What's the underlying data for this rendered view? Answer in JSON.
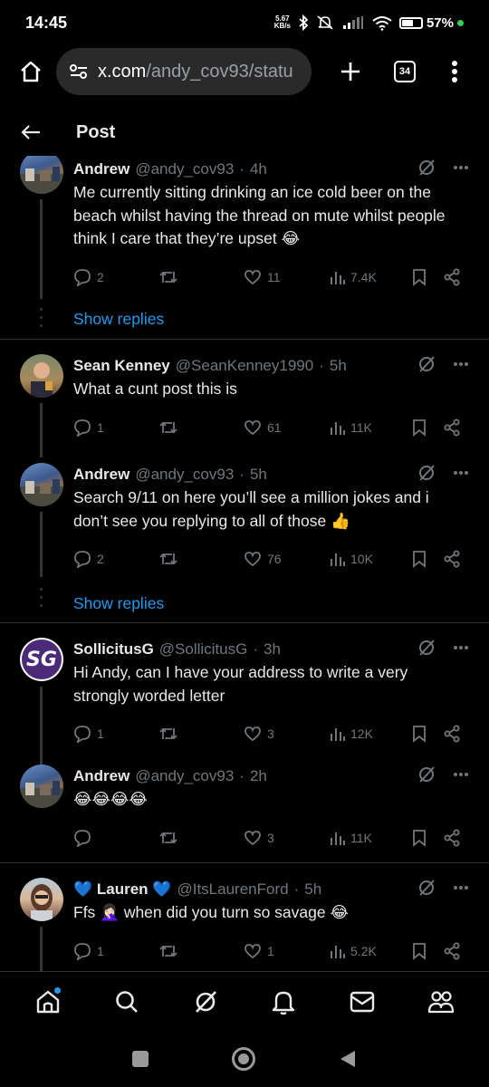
{
  "status_bar": {
    "time": "14:45",
    "net_speed_value": "5.67",
    "net_speed_unit": "KB/s",
    "battery": "57%"
  },
  "browser": {
    "url_host": "x.com",
    "url_path": "/andy_cov93/statu",
    "tab_count": "34"
  },
  "header": {
    "title": "Post"
  },
  "replies": [
    {
      "name": "Andrew",
      "handle": "@andy_cov93",
      "time": "4h",
      "text": "Me currently sitting drinking an ice cold beer on the beach whilst having the thread on mute whilst people think I care that they’re upset 😂",
      "replies": "2",
      "likes": "11",
      "views": "7.4K",
      "show_replies": "Show replies"
    },
    {
      "name": "Sean Kenney",
      "handle": "@SeanKenney1990",
      "time": "5h",
      "text": "What a cunt post this is",
      "replies": "1",
      "likes": "61",
      "views": "11K"
    },
    {
      "name": "Andrew",
      "handle": "@andy_cov93",
      "time": "5h",
      "text": "Search 9/11 on here you’ll see a million jokes and i don’t see you replying to all of those 👍",
      "replies": "2",
      "likes": "76",
      "views": "10K",
      "show_replies": "Show replies"
    },
    {
      "name": "SollicitusG",
      "handle": "@SollicitusG",
      "time": "3h",
      "text": "Hi Andy, can I have your address to write a very strongly worded letter",
      "replies": "1",
      "likes": "3",
      "views": "12K",
      "avatar_text": "SG"
    },
    {
      "name": "Andrew",
      "handle": "@andy_cov93",
      "time": "2h",
      "text": "😂😂😂😂",
      "replies": "",
      "likes": "3",
      "views": "11K"
    },
    {
      "name": "💙 Lauren 💙",
      "handle": "@ItsLaurenFord",
      "time": "5h",
      "text": "Ffs 🤦🏻‍♀️ when did you turn so savage 😂",
      "replies": "1",
      "likes": "1",
      "views": "5.2K"
    }
  ],
  "colors": {
    "accent": "#1d9bf0",
    "background": "#000000",
    "muted": "#71767b"
  },
  "icons": [
    "home-icon",
    "search-icon",
    "grok-icon",
    "notifications-icon",
    "messages-icon",
    "communities-icon"
  ]
}
